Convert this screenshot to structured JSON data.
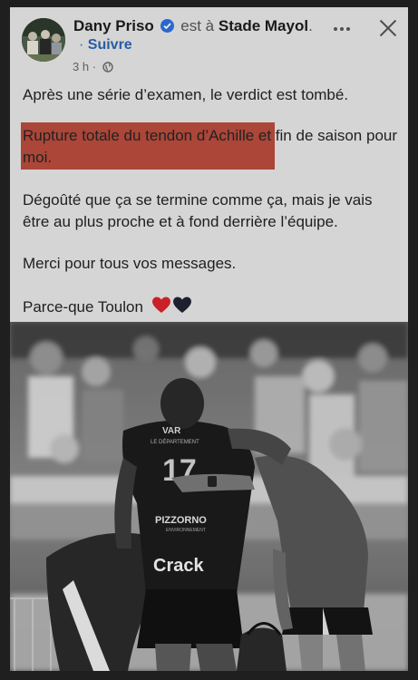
{
  "post": {
    "author": "Dany Priso",
    "at_text": "est à",
    "place": "Stade Mayol",
    "place_suffix": ".",
    "follow_dot": "·",
    "follow_label": "Suivre",
    "time": "3 h",
    "time_sep": "·",
    "visibility_icon": "globe-icon",
    "verified_icon": "verified-badge-icon",
    "menu_icon": "more-options-icon",
    "close_icon": "close-icon"
  },
  "body": {
    "p1": "Après une série d’examen, le verdict est tombé.",
    "p2_highlight": "Rupture totale du tendon d’Achille",
    "p2_rest": " et fin de saison pour moi.",
    "p3": "Dégoûté que ça se termine comme ça, mais je vais être au plus proche et à fond derrière l’équipe.",
    "p4": "Merci pour tous vos messages.",
    "p5": "Parce-que Toulon",
    "p5_emojis": [
      "red-heart-icon",
      "black-heart-icon"
    ]
  },
  "photo": {
    "jersey_sponsor_top": "VAR",
    "jersey_sponsor_sub": "LE DÉPARTEMENT",
    "jersey_number": "17",
    "jersey_sponsor_mid": "PIZZORNO",
    "jersey_sponsor_mid_sub": "ENVIRONNEMENT",
    "jersey_sponsor_main": "Crack"
  },
  "colors": {
    "highlight": "#b64b3c",
    "follow_link": "#2a63b0",
    "verified": "#2d6fd9",
    "heart_red": "#d8232a",
    "heart_black": "#1e2430"
  }
}
